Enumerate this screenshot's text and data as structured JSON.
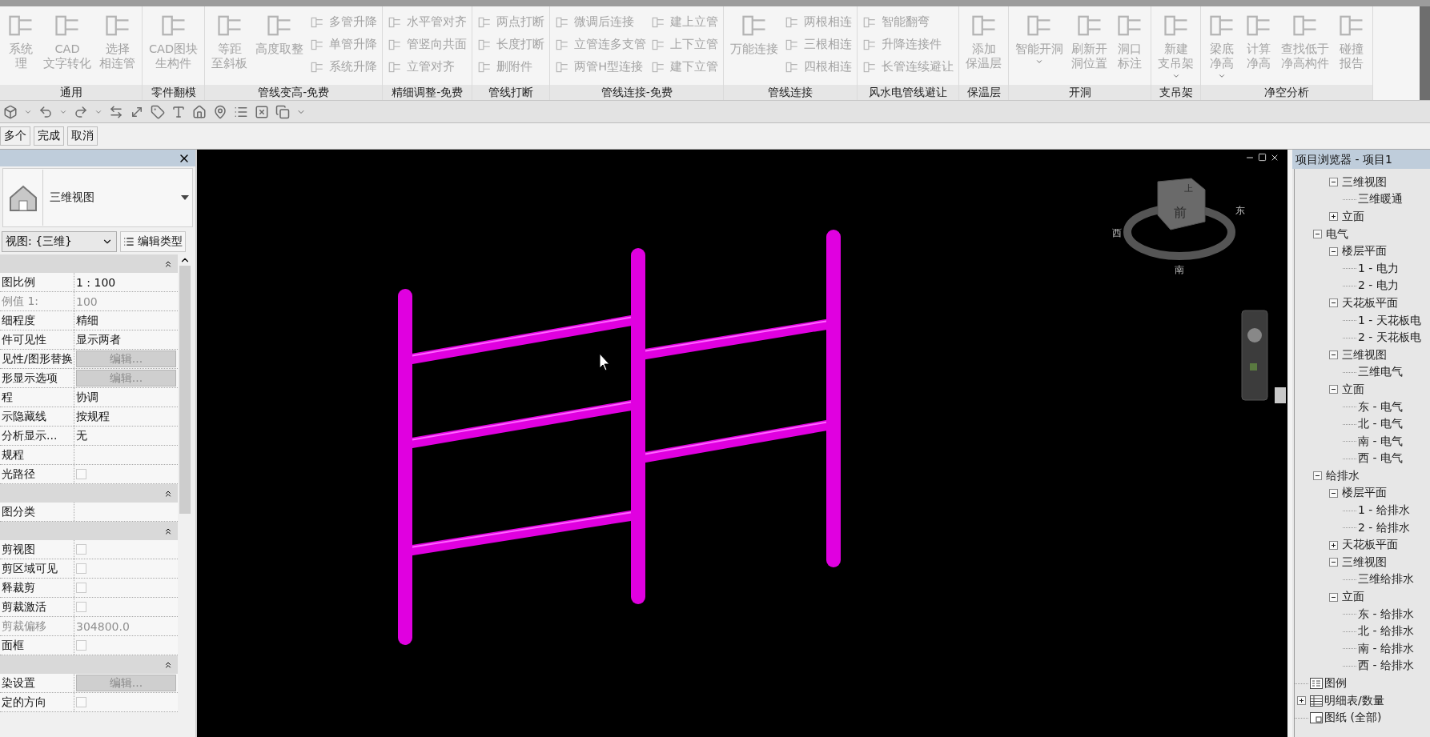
{
  "ribbon": {
    "groups": [
      {
        "label": "通用",
        "items": [
          {
            "kind": "large",
            "label": [
              "系统",
              "理"
            ],
            "menu": false
          },
          {
            "kind": "large",
            "label": [
              "CAD",
              "文字转化"
            ],
            "menu": false
          },
          {
            "kind": "large",
            "label": [
              "选择",
              "相连管"
            ],
            "menu": false
          }
        ]
      },
      {
        "label": "零件翻模",
        "items": [
          {
            "kind": "large",
            "label": [
              "CAD图块",
              "生构件"
            ],
            "menu": false
          }
        ]
      },
      {
        "label": "管线变高-免费",
        "items": [
          {
            "kind": "large",
            "label": [
              "等距",
              "至斜板"
            ],
            "menu": false
          },
          {
            "kind": "large",
            "label": [
              "高度取整"
            ],
            "menu": false
          },
          {
            "kind": "stack",
            "rows": [
              "多管升降",
              "单管升降",
              "系统升降"
            ]
          }
        ]
      },
      {
        "label": "精细调整-免费",
        "items": [
          {
            "kind": "stack",
            "rows": [
              "水平管对齐",
              "管竖向共面",
              "立管对齐"
            ]
          }
        ]
      },
      {
        "label": "管线打断",
        "items": [
          {
            "kind": "stack",
            "rows": [
              "两点打断",
              "长度打断",
              "删附件"
            ]
          }
        ]
      },
      {
        "label": "管线连接-免费",
        "items": [
          {
            "kind": "stack",
            "rows": [
              "微调后连接",
              "立管连多支管",
              "两管H型连接"
            ]
          },
          {
            "kind": "stack",
            "rows": [
              "建上立管",
              "上下立管",
              "建下立管"
            ]
          }
        ]
      },
      {
        "label": "管线连接",
        "items": [
          {
            "kind": "large",
            "label": [
              "万能连接"
            ],
            "menu": false
          },
          {
            "kind": "stack",
            "rows": [
              "两根相连",
              "三根相连",
              "四根相连"
            ]
          }
        ]
      },
      {
        "label": "风水电管线避让",
        "items": [
          {
            "kind": "stack",
            "rows": [
              "智能翻弯",
              "升降连接件",
              "长管连续避让"
            ]
          }
        ]
      },
      {
        "label": "保温层",
        "items": [
          {
            "kind": "large",
            "label": [
              "添加",
              "保温层"
            ],
            "menu": false
          }
        ]
      },
      {
        "label": "开洞",
        "items": [
          {
            "kind": "large",
            "label": [
              "智能开洞"
            ],
            "menu": true
          },
          {
            "kind": "large",
            "label": [
              "刷新开",
              "洞位置"
            ],
            "menu": false
          },
          {
            "kind": "large",
            "label": [
              "洞口",
              "标注"
            ],
            "menu": false
          }
        ]
      },
      {
        "label": "支吊架",
        "items": [
          {
            "kind": "large",
            "label": [
              "新建",
              "支吊架"
            ],
            "menu": true
          }
        ]
      },
      {
        "label": "净空分析",
        "items": [
          {
            "kind": "large",
            "label": [
              "梁底",
              "净高"
            ],
            "menu": true
          },
          {
            "kind": "large",
            "label": [
              "计算",
              "净高"
            ],
            "menu": false
          },
          {
            "kind": "large",
            "label": [
              "查找低于",
              "净高构件"
            ],
            "menu": false
          },
          {
            "kind": "large",
            "label": [
              "碰撞",
              "报告"
            ],
            "menu": false
          }
        ]
      }
    ]
  },
  "options_bar": {
    "buttons": [
      "多个",
      "完成",
      "取消"
    ]
  },
  "properties": {
    "type_name": "三维视图",
    "instance_selector": "视图: {三维}",
    "edit_type": "编辑类型",
    "sections": [
      {
        "rows": [
          {
            "name": "图比例",
            "kind": "text",
            "value": "1 : 100",
            "disabled": false
          },
          {
            "name": "例值 1:",
            "kind": "text",
            "value": "100",
            "disabled": true
          },
          {
            "name": "细程度",
            "kind": "text",
            "value": "精细",
            "disabled": false
          },
          {
            "name": "件可见性",
            "kind": "text",
            "value": "显示两者",
            "disabled": false
          },
          {
            "name": "见性/图形替换",
            "kind": "button",
            "value": "编辑...",
            "disabled": false
          },
          {
            "name": "形显示选项",
            "kind": "button",
            "value": "编辑...",
            "disabled": false
          },
          {
            "name": "程",
            "kind": "text",
            "value": "协调",
            "disabled": false
          },
          {
            "name": "示隐藏线",
            "kind": "text",
            "value": "按规程",
            "disabled": false
          },
          {
            "name": "分析显示...",
            "kind": "text",
            "value": "无",
            "disabled": false
          },
          {
            "name": "规程",
            "kind": "text",
            "disabled": false
          },
          {
            "name": "光路径",
            "kind": "checkbox",
            "checked": false,
            "disabled": false
          }
        ]
      },
      {
        "rows": [
          {
            "name": "图分类",
            "kind": "text",
            "disabled": false
          }
        ]
      },
      {
        "rows": [
          {
            "name": "剪视图",
            "kind": "checkbox",
            "checked": false,
            "disabled": false
          },
          {
            "name": "剪区域可见",
            "kind": "checkbox",
            "checked": false,
            "disabled": false
          },
          {
            "name": "释裁剪",
            "kind": "checkbox",
            "checked": false,
            "disabled": false
          },
          {
            "name": "剪裁激活",
            "kind": "checkbox",
            "checked": false,
            "disabled": false
          },
          {
            "name": "剪裁偏移",
            "kind": "text",
            "value": "304800.0",
            "disabled": true
          },
          {
            "name": "面框",
            "kind": "checkbox",
            "checked": false,
            "disabled": false
          }
        ]
      },
      {
        "rows": [
          {
            "name": "染设置",
            "kind": "button",
            "value": "编辑...",
            "disabled": false
          },
          {
            "name": "定的方向",
            "kind": "checkbox",
            "checked": false,
            "disabled": false
          }
        ]
      }
    ]
  },
  "viewport": {
    "view_cube": {
      "front": "前",
      "top": "上",
      "compass": [
        "西",
        "南",
        "东"
      ]
    }
  },
  "project_browser": {
    "title": "项目浏览器 - 项目1",
    "tree": [
      {
        "children": [
          {
            "children": [
              {
                "label": "三维视图",
                "expanded": true,
                "children": [
                  {
                    "label": "三维暖通"
                  }
                ]
              },
              {
                "label": "立面",
                "expanded": false
              }
            ]
          },
          {
            "label": "电气",
            "expanded": true,
            "children": [
              {
                "label": "楼层平面",
                "expanded": true,
                "children": [
                  {
                    "label": "1 - 电力"
                  },
                  {
                    "label": "2 - 电力"
                  }
                ]
              },
              {
                "label": "天花板平面",
                "expanded": true,
                "children": [
                  {
                    "label": "1 - 天花板电"
                  },
                  {
                    "label": "2 - 天花板电"
                  }
                ]
              },
              {
                "label": "三维视图",
                "expanded": true,
                "children": [
                  {
                    "label": "三维电气"
                  }
                ]
              },
              {
                "label": "立面",
                "expanded": true,
                "children": [
                  {
                    "label": "东 - 电气"
                  },
                  {
                    "label": "北 - 电气"
                  },
                  {
                    "label": "南 - 电气"
                  },
                  {
                    "label": "西 - 电气"
                  }
                ]
              }
            ]
          },
          {
            "label": "给排水",
            "expanded": true,
            "children": [
              {
                "label": "楼层平面",
                "expanded": true,
                "children": [
                  {
                    "label": "1 - 给排水"
                  },
                  {
                    "label": "2 - 给排水"
                  }
                ]
              },
              {
                "label": "天花板平面",
                "expanded": false
              },
              {
                "label": "三维视图",
                "expanded": true,
                "children": [
                  {
                    "label": "三维给排水"
                  }
                ]
              },
              {
                "label": "立面",
                "expanded": true,
                "children": [
                  {
                    "label": "东 - 给排水"
                  },
                  {
                    "label": "北 - 给排水"
                  },
                  {
                    "label": "南 - 给排水"
                  },
                  {
                    "label": "西 - 给排水"
                  }
                ]
              }
            ]
          }
        ]
      },
      {
        "label": "图例",
        "kind": "legend"
      },
      {
        "label": "明细表/数量",
        "kind": "schedule",
        "expanded": false
      },
      {
        "label": "图纸 (全部)",
        "kind": "sheet"
      }
    ]
  }
}
